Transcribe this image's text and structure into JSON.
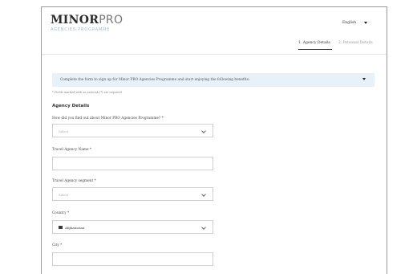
{
  "brand": {
    "name_bold": "MINOR",
    "name_light": "PRO",
    "subtitle": "AGENCIES PROGRAMME"
  },
  "language": {
    "selected": "English"
  },
  "steps": [
    {
      "label": "1. Agency Details"
    },
    {
      "label": "2. Personal Details"
    }
  ],
  "banner": {
    "text": "Complete the form to sign up for Minor PRO Agencies Programme and start enjoying the following benefits:"
  },
  "required_note": "* Fields marked with an asterisk (*) are required",
  "section_title": "Agency Details",
  "fields": {
    "find_out": {
      "label": "How did you find out about Minor PRO Agencies Programme? *",
      "value": "Select"
    },
    "agency_name": {
      "label": "Travel Agency Name *",
      "value": ""
    },
    "segment": {
      "label": "Travel Agency segment *",
      "value": "Select"
    },
    "country": {
      "label": "Country *",
      "value": "Afghanistan"
    },
    "city": {
      "label": "City *",
      "value": ""
    }
  }
}
